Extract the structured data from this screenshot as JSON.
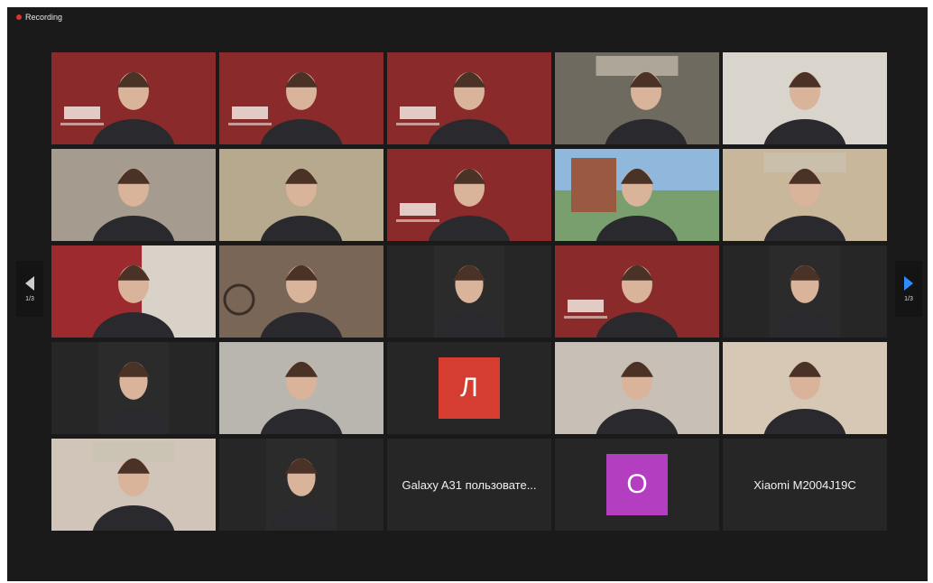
{
  "recording": {
    "label": "Recording",
    "color": "#e0322c"
  },
  "pagination": {
    "left_label": "1/3",
    "right_label": "1/3"
  },
  "tiles": [
    {
      "kind": "video",
      "bg": "#8a2a2a",
      "scene": "branded-red",
      "has_logo": true
    },
    {
      "kind": "video",
      "bg": "#8a2a2a",
      "scene": "branded-red",
      "has_logo": true
    },
    {
      "kind": "video",
      "bg": "#8a2a2a",
      "scene": "branded-red",
      "has_logo": true
    },
    {
      "kind": "video",
      "bg": "#6f6a60",
      "scene": "office"
    },
    {
      "kind": "video",
      "bg": "#d9d4cc",
      "scene": "room-light"
    },
    {
      "kind": "video",
      "bg": "#a59c8f",
      "scene": "kitchen"
    },
    {
      "kind": "video",
      "bg": "#b7a98e",
      "scene": "wall"
    },
    {
      "kind": "video",
      "bg": "#8a2a2a",
      "scene": "branded-red",
      "has_logo": true
    },
    {
      "kind": "video",
      "bg": "#7a9f6f",
      "scene": "outdoor-building",
      "active": true
    },
    {
      "kind": "video",
      "bg": "#c9b79c",
      "scene": "room-warm"
    },
    {
      "kind": "video",
      "bg": "#9c2a2e",
      "scene": "red-curtain"
    },
    {
      "kind": "video",
      "bg": "#7a6656",
      "scene": "bicycle-room"
    },
    {
      "kind": "video",
      "bg": "#2b2b2b",
      "scene": "dark-portrait",
      "inset": true
    },
    {
      "kind": "video",
      "bg": "#8a2a2a",
      "scene": "branded-red",
      "has_logo": true
    },
    {
      "kind": "video",
      "bg": "#2b2b2b",
      "scene": "light-room",
      "inset": true
    },
    {
      "kind": "video",
      "bg": "#2b2b2b",
      "scene": "window-room",
      "inset": true
    },
    {
      "kind": "video",
      "bg": "#b9b6b0",
      "scene": "plain-wall"
    },
    {
      "kind": "avatar",
      "initial": "Л",
      "color": "#d43d2f"
    },
    {
      "kind": "video",
      "bg": "#c8c0b6",
      "scene": "stone-wall"
    },
    {
      "kind": "video",
      "bg": "#d7c8b5",
      "scene": "room-beige"
    },
    {
      "kind": "video",
      "bg": "#d0c5b8",
      "scene": "living-room"
    },
    {
      "kind": "video",
      "bg": "#2b2b2b",
      "scene": "garden",
      "inset": true
    },
    {
      "kind": "name",
      "name": "Galaxy A31 пользовате..."
    },
    {
      "kind": "avatar",
      "initial": "О",
      "color": "#b33fc0"
    },
    {
      "kind": "name",
      "name": "Xiaomi M2004J19C"
    }
  ]
}
